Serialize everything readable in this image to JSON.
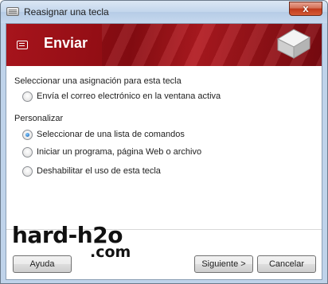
{
  "window": {
    "title": "Reasignar una tecla",
    "close_label": "x"
  },
  "banner": {
    "title": "Enviar"
  },
  "assignment": {
    "heading": "Seleccionar una asignación para esta tecla",
    "options": [
      {
        "label": "Envía el correo electrónico en la ventana activa",
        "checked": false
      }
    ]
  },
  "customize": {
    "heading": "Personalizar",
    "options": [
      {
        "label": "Seleccionar de una lista de comandos",
        "checked": true
      },
      {
        "label": "Iniciar un programa, página Web o archivo",
        "checked": false
      },
      {
        "label": "Deshabilitar el uso de esta tecla",
        "checked": false
      }
    ]
  },
  "watermark": {
    "line1": "hard-h2o",
    "line2": ".com"
  },
  "buttons": {
    "help": "Ayuda",
    "next": "Siguiente >",
    "cancel": "Cancelar"
  }
}
